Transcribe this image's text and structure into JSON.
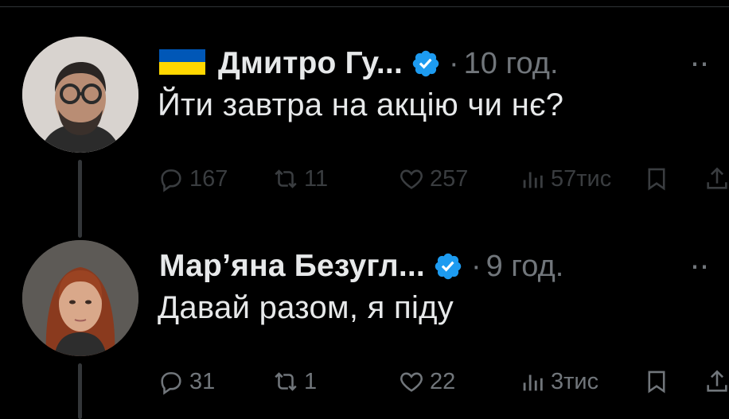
{
  "tweets": [
    {
      "author_name": "Дмитро Гу...",
      "separator": "·",
      "time": "10 год.",
      "text": "Йти завтра на акцію чи нє?",
      "has_flag": true,
      "counts": {
        "replies": "167",
        "retweets": "11",
        "likes": "257",
        "views": "57тис"
      }
    },
    {
      "author_name": "Мар’яна Безугл...",
      "separator": "·",
      "time": "9 год.",
      "text": "Давай разом, я піду",
      "has_flag": false,
      "counts": {
        "replies": "31",
        "retweets": "1",
        "likes": "22",
        "views": "3тис"
      }
    }
  ],
  "colors": {
    "background": "#000000",
    "text": "#e7e9ea",
    "muted": "#71767b",
    "verified": "#1d9bf0",
    "flag_blue": "#0057b7",
    "flag_yellow": "#ffd700"
  },
  "icons": [
    "ukraine-flag-icon",
    "verified-badge-icon",
    "more-icon",
    "reply-icon",
    "retweet-icon",
    "like-icon",
    "views-icon",
    "bookmark-icon",
    "share-icon"
  ]
}
